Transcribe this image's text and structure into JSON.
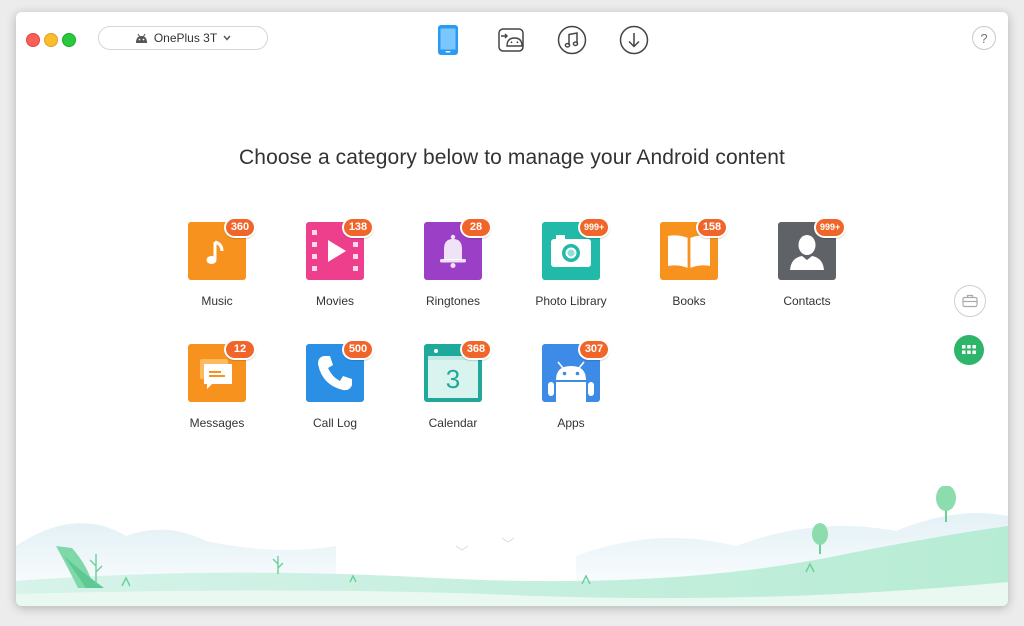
{
  "window": {
    "device_selector": {
      "label": "OnePlus 3T",
      "icon": "android-icon",
      "chevron": "chevron-down-icon"
    },
    "toolbar": [
      {
        "name": "device-manager-tab",
        "icon": "phone-icon",
        "active": true
      },
      {
        "name": "android-mover-tab",
        "icon": "android-transfer-icon",
        "active": false
      },
      {
        "name": "ringtone-maker-tab",
        "icon": "music-note-icon",
        "active": false
      },
      {
        "name": "downloader-tab",
        "icon": "download-icon",
        "active": false
      }
    ],
    "help_label": "?"
  },
  "main": {
    "headline": "Choose a category below to manage your Android content",
    "categories": [
      {
        "label": "Music",
        "count": "360",
        "icon": "music-icon",
        "color": "#f7921e"
      },
      {
        "label": "Movies",
        "count": "138",
        "icon": "movies-icon",
        "color": "#ee3f8d"
      },
      {
        "label": "Ringtones",
        "count": "28",
        "icon": "bell-icon",
        "color": "#9b3fc6"
      },
      {
        "label": "Photo Library",
        "count": "999+",
        "icon": "camera-icon",
        "color": "#21b9a7"
      },
      {
        "label": "Books",
        "count": "158",
        "icon": "book-icon",
        "color": "#f7921e"
      },
      {
        "label": "Contacts",
        "count": "999+",
        "icon": "contact-icon",
        "color": "#5f6368"
      },
      {
        "label": "Messages",
        "count": "12",
        "icon": "message-icon",
        "color": "#f7921e"
      },
      {
        "label": "Call Log",
        "count": "500",
        "icon": "phone-call-icon",
        "color": "#2b8fe6"
      },
      {
        "label": "Calendar",
        "count": "368",
        "icon": "calendar-icon",
        "color": "#1fa99a",
        "day": "3"
      },
      {
        "label": "Apps",
        "count": "307",
        "icon": "android-apps-icon",
        "color": "#3d8be6"
      }
    ]
  },
  "side_buttons": [
    {
      "name": "toolbox-button",
      "icon": "toolbox-icon"
    },
    {
      "name": "category-grid-button",
      "icon": "grid-icon",
      "color": "#2db56a"
    }
  ]
}
